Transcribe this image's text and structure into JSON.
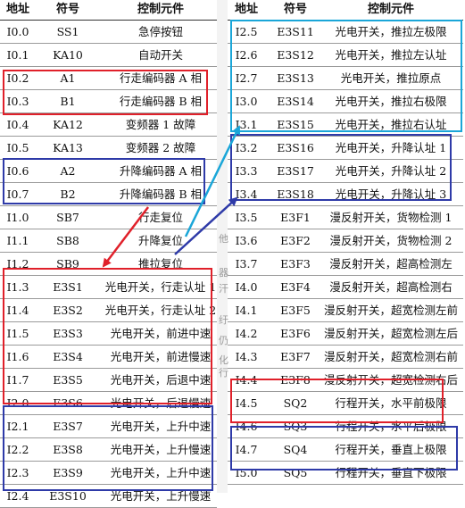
{
  "left_table": {
    "headers": [
      "地址",
      "符号",
      "控制元件"
    ],
    "rows": [
      [
        "I0.0",
        "SS1",
        "急停按钮"
      ],
      [
        "I0.1",
        "KA10",
        "自动开关"
      ],
      [
        "I0.2",
        "A1",
        "行走编码器 A 相"
      ],
      [
        "I0.3",
        "B1",
        "行走编码器 B 相"
      ],
      [
        "I0.4",
        "KA12",
        "变频器 1 故障"
      ],
      [
        "I0.5",
        "KA13",
        "变频器 2 故障"
      ],
      [
        "I0.6",
        "A2",
        "升降编码器 A 相"
      ],
      [
        "I0.7",
        "B2",
        "升降编码器 B 相"
      ],
      [
        "I1.0",
        "SB7",
        "行走复位"
      ],
      [
        "I1.1",
        "SB8",
        "升降复位"
      ],
      [
        "I1.2",
        "SB9",
        "推拉复位"
      ],
      [
        "I1.3",
        "E3S1",
        "光电开关，行走认址 1"
      ],
      [
        "I1.4",
        "E3S2",
        "光电开关，行走认址 2"
      ],
      [
        "I1.5",
        "E3S3",
        "光电开关，前进中速"
      ],
      [
        "I1.6",
        "E3S4",
        "光电开关，前进慢速"
      ],
      [
        "I1.7",
        "E3S5",
        "光电开关，后退中速"
      ],
      [
        "I2.0",
        "E3S6",
        "光电开关，后退慢速"
      ],
      [
        "I2.1",
        "E3S7",
        "光电开关，上升中速"
      ],
      [
        "I2.2",
        "E3S8",
        "光电开关，上升慢速"
      ],
      [
        "I2.3",
        "E3S9",
        "光电开关，上升中速"
      ],
      [
        "I2.4",
        "E3S10",
        "光电开关，上升慢速"
      ]
    ]
  },
  "right_table": {
    "headers": [
      "地址",
      "符号",
      "控制元件"
    ],
    "rows": [
      [
        "I2.5",
        "E3S11",
        "光电开关，推拉左极限"
      ],
      [
        "I2.6",
        "E3S12",
        "光电开关，推拉左认址"
      ],
      [
        "I2.7",
        "E3S13",
        "光电开关，推拉原点"
      ],
      [
        "I3.0",
        "E3S14",
        "光电开关，推拉右极限"
      ],
      [
        "I3.1",
        "E3S15",
        "光电开关，推拉右认址"
      ],
      [
        "I3.2",
        "E3S16",
        "光电开关，升降认址 1"
      ],
      [
        "I3.3",
        "E3S17",
        "光电开关，升降认址 2"
      ],
      [
        "I3.4",
        "E3S18",
        "光电开关，升降认址 3"
      ],
      [
        "I3.5",
        "E3F1",
        "漫反射开关，货物检测 1"
      ],
      [
        "I3.6",
        "E3F2",
        "漫反射开关，货物检测 2"
      ],
      [
        "I3.7",
        "E3F3",
        "漫反射开关，超高检测左"
      ],
      [
        "I4.0",
        "E3F4",
        "漫反射开关，超高检测右"
      ],
      [
        "I4.1",
        "E3F5",
        "漫反射开关，超宽检测左前"
      ],
      [
        "I4.2",
        "E3F6",
        "漫反射开关，超宽检测左后"
      ],
      [
        "I4.3",
        "E3F7",
        "漫反射开关，超宽检测右前"
      ],
      [
        "I4.4",
        "E3F8",
        "漫反射开关，超宽检测右后"
      ],
      [
        "I4.5",
        "SQ2",
        "行程开关，水平前极限"
      ],
      [
        "I4.6",
        "SQ3",
        "行程开关，水平后极限"
      ],
      [
        "I4.7",
        "SQ4",
        "行程开关，垂直上极限"
      ],
      [
        "I5.0",
        "SQ5",
        "行程开关，垂直下极限"
      ]
    ]
  },
  "background_glyphs": [
    "他",
    "器",
    "汗",
    "纡",
    "仍",
    "化",
    "行"
  ],
  "colors": {
    "red": "#e0202a",
    "blue": "#2e3aa8",
    "cyan": "#1aa6d8",
    "grid": "#9a9a9a"
  }
}
